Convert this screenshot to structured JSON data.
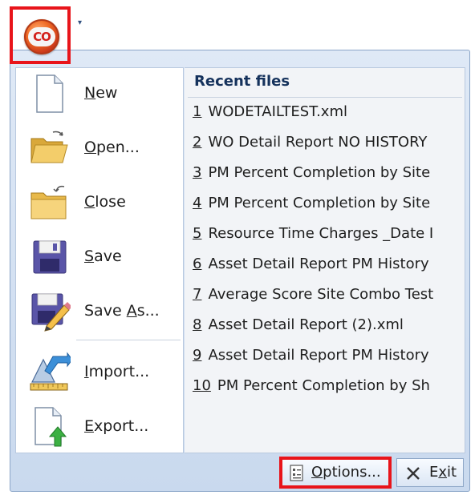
{
  "app_menu": {
    "orb_text": "CO",
    "quick_access_arrow": "▾"
  },
  "menu_items": [
    {
      "pre": "",
      "ul": "N",
      "post": "ew",
      "icon": "new-document-icon"
    },
    {
      "pre": "",
      "ul": "O",
      "post": "pen...",
      "icon": "open-folder-icon"
    },
    {
      "pre": "",
      "ul": "C",
      "post": "lose",
      "icon": "close-folder-icon"
    },
    {
      "pre": "",
      "ul": "S",
      "post": "ave",
      "icon": "save-disk-icon"
    },
    {
      "pre": "Save ",
      "ul": "A",
      "post": "s...",
      "icon": "save-as-icon"
    },
    {
      "pre": "",
      "ul": "I",
      "post": "mport...",
      "icon": "import-icon"
    },
    {
      "pre": "",
      "ul": "E",
      "post": "xport...",
      "icon": "export-icon"
    }
  ],
  "recent": {
    "header": "Recent files",
    "files": [
      {
        "num": "1",
        "name": "WODETAILTEST.xml"
      },
      {
        "num": "2",
        "name": "WO Detail Report NO HISTORY"
      },
      {
        "num": "3",
        "name": "PM Percent Completion by Site"
      },
      {
        "num": "4",
        "name": "PM Percent Completion by Site"
      },
      {
        "num": "5",
        "name": "Resource Time Charges _Date I"
      },
      {
        "num": "6",
        "name": "Asset Detail Report PM History"
      },
      {
        "num": "7",
        "name": "Average Score Site Combo Test"
      },
      {
        "num": "8",
        "name": "Asset Detail Report (2).xml"
      },
      {
        "num": "9",
        "name": "Asset Detail Report PM History"
      },
      {
        "num": "10",
        "name": "PM Percent Completion by Sh"
      }
    ]
  },
  "buttons": {
    "options": {
      "ul": "O",
      "post": "ptions...",
      "icon": "options-icon"
    },
    "exit": {
      "pre": "E",
      "ul": "x",
      "post": "it",
      "icon": "close-x-icon"
    }
  },
  "colors": {
    "highlight_border": "#e8141a",
    "header_text": "#15325c",
    "frame": "#dfe9f6"
  }
}
